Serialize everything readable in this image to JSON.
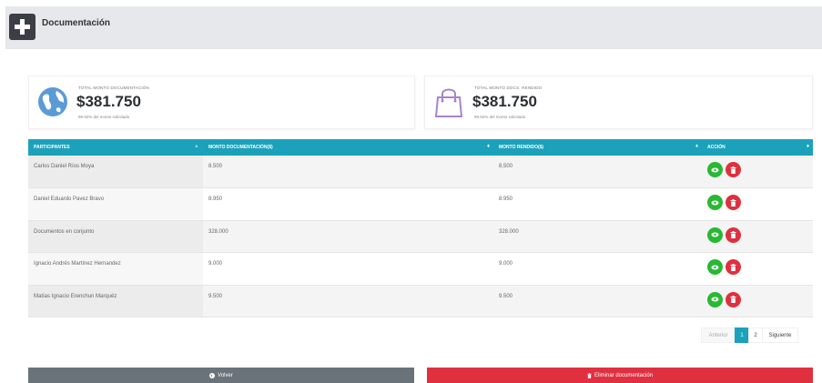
{
  "header": {
    "title": "Documentación",
    "icon": "plus-square-icon"
  },
  "cards": [
    {
      "label": "TOTAL MONTO DOCUMENTACIÓN",
      "value": "$381.750",
      "note": "99.92% del monto solicitado",
      "icon": "globe-icon",
      "icon_color": "#5b9bd5"
    },
    {
      "label": "TOTAL MONTO DOCS. RENDIDO",
      "value": "$381.750",
      "note": "99.92% del monto solicitado",
      "icon": "shopping-bag-icon",
      "icon_color": "#a884c9"
    }
  ],
  "table": {
    "headers": [
      "PARTICIPANTES",
      "MONTO DOCUMENTACIÓN($)",
      "MONTO RENDIDO($)",
      "ACCIÓN"
    ],
    "rows": [
      {
        "participante": "Carlos Daniel Ríos Moya",
        "monto_doc": "8.500",
        "monto_rendido": "8.500"
      },
      {
        "participante": "Daniel Eduardo Pavez Bravo",
        "monto_doc": "8.950",
        "monto_rendido": "8.950"
      },
      {
        "participante": "Documentos en conjunto",
        "monto_doc": "328.000",
        "monto_rendido": "328.000"
      },
      {
        "participante": "Ignacio Andrés Martínez Hernandez",
        "monto_doc": "9.000",
        "monto_rendido": "9.000"
      },
      {
        "participante": "Matías Ignacio Erenchun Marquéz",
        "monto_doc": "9.500",
        "monto_rendido": "9.500"
      }
    ]
  },
  "pagination": {
    "prev": "Anterior",
    "pages": [
      "1",
      "2"
    ],
    "active": "1",
    "next": "Siguiente"
  },
  "buttons": {
    "back": "Volver",
    "delete": "Eliminar documentación"
  },
  "colors": {
    "accent": "#1ba2ba",
    "success": "#28b833",
    "danger": "#e0303f",
    "secondary": "#6b737a"
  }
}
